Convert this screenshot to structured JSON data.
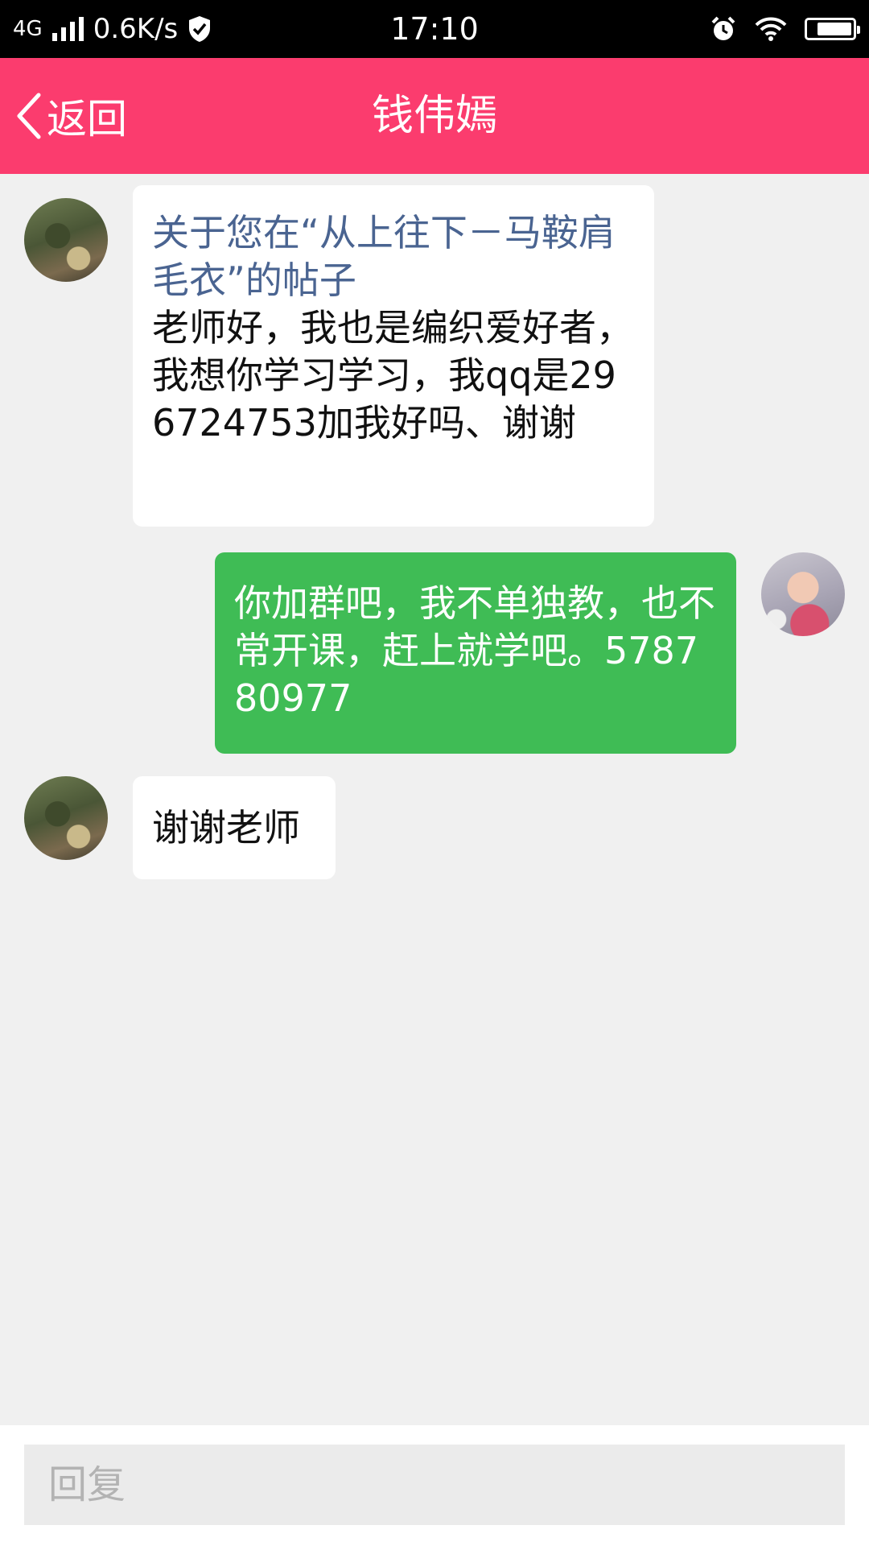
{
  "status_bar": {
    "network_type": "4G",
    "speed": "0.6K/s",
    "time": "17:10",
    "battery_level": 0.8,
    "icons": [
      "signal-icon",
      "shield-icon",
      "alarm-icon",
      "wifi-icon",
      "battery-icon"
    ]
  },
  "nav": {
    "back_label": "返回",
    "title": "钱伟嫣",
    "background_color": "#fb3c6e"
  },
  "messages": [
    {
      "sender": "other",
      "post_ref": "关于您在“从上往下－马鞍肩毛衣”的帖子",
      "text": "老师好，我也是编织爱好者，我想你学习学习，我qq是296724753加我好吗、谢谢"
    },
    {
      "sender": "self",
      "text": "你加群吧，我不单独教，也不常开课，赶上就学吧。578780977"
    },
    {
      "sender": "other",
      "text": "谢谢老师"
    }
  ],
  "reply": {
    "placeholder": "回复",
    "value": ""
  },
  "colors": {
    "self_bubble": "#3fbc55",
    "other_bubble": "#ffffff",
    "post_ref_text": "#4a6491",
    "background": "#f0f0f0"
  }
}
